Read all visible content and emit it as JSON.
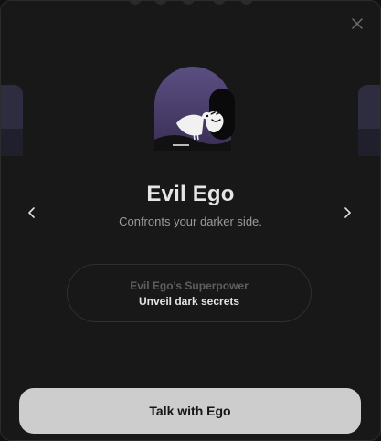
{
  "persona": {
    "name": "Evil Ego",
    "description": "Confronts your darker side."
  },
  "superpower": {
    "label": "Evil Ego's Superpower",
    "value": "Unveil dark secrets"
  },
  "cta": {
    "label": "Talk with Ego"
  },
  "icons": {
    "close": "close-icon",
    "prev": "chevron-left-icon",
    "next": "chevron-right-icon",
    "illustration": "evil-ego-illustration"
  },
  "colors": {
    "background": "#181818",
    "arch_gradient_top": "#5b4f82",
    "arch_gradient_bottom": "#3a2f55",
    "button_bg": "#cdcdcd",
    "title_text": "#e6e6e6",
    "muted_text": "#9a9a9a"
  }
}
